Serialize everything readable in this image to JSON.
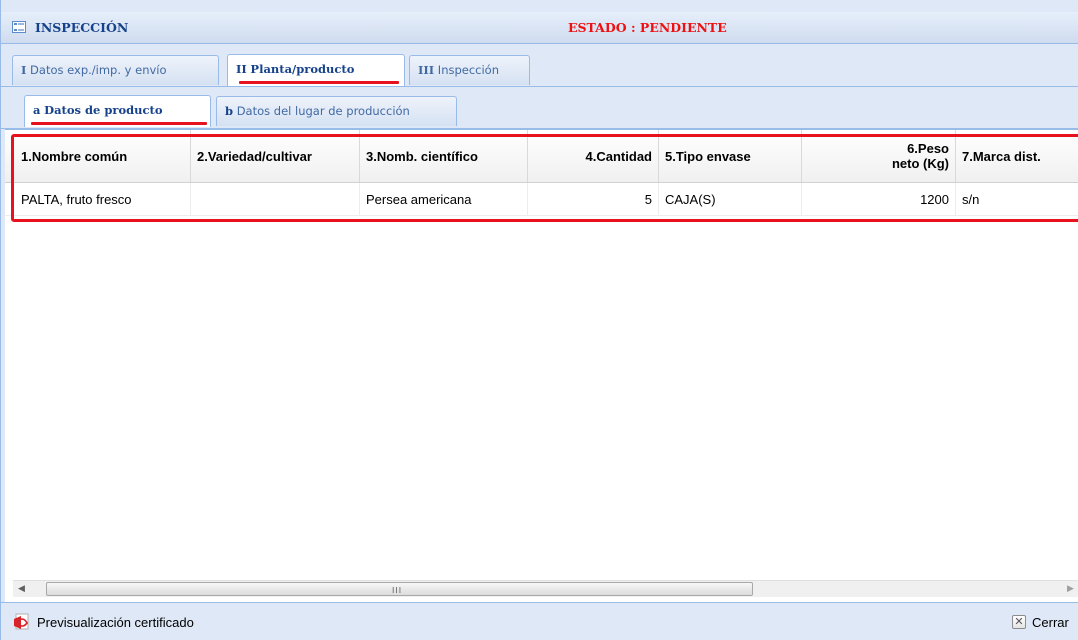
{
  "window": {
    "title": "INSPECCIÓN",
    "status": "ESTADO : PENDIENTE"
  },
  "main_tabs": [
    {
      "num": "I",
      "label": "Datos exp./imp. y envío",
      "active": false
    },
    {
      "num": "II",
      "label": "Planta/producto",
      "active": true
    },
    {
      "num": "III",
      "label": "Inspección",
      "active": false
    }
  ],
  "sub_tabs": [
    {
      "num": "a",
      "label": "Datos de producto",
      "active": true
    },
    {
      "num": "b",
      "label": "Datos del lugar de producción",
      "active": false
    }
  ],
  "grid": {
    "columns": [
      "1.Nombre común",
      "2.Variedad/cultivar",
      "3.Nomb. científico",
      "4.Cantidad",
      "5.Tipo envase",
      "6.Peso neto (Kg)",
      "7.Marca dist."
    ],
    "rows": [
      [
        "PALTA, fruto fresco",
        "",
        "Persea americana",
        "5",
        "CAJA(S)",
        "1200",
        "s/n"
      ]
    ]
  },
  "scrollbar": {
    "grip": "III"
  },
  "footer": {
    "preview_label": "Previsualización certificado",
    "close_label": "Cerrar"
  },
  "colors": {
    "accent": "#15428b",
    "highlight": "#e8121f",
    "status": "#ee1111"
  },
  "icons": [
    "form-icon",
    "pdf-icon",
    "close-icon",
    "arrow-left-icon",
    "arrow-right-icon"
  ]
}
